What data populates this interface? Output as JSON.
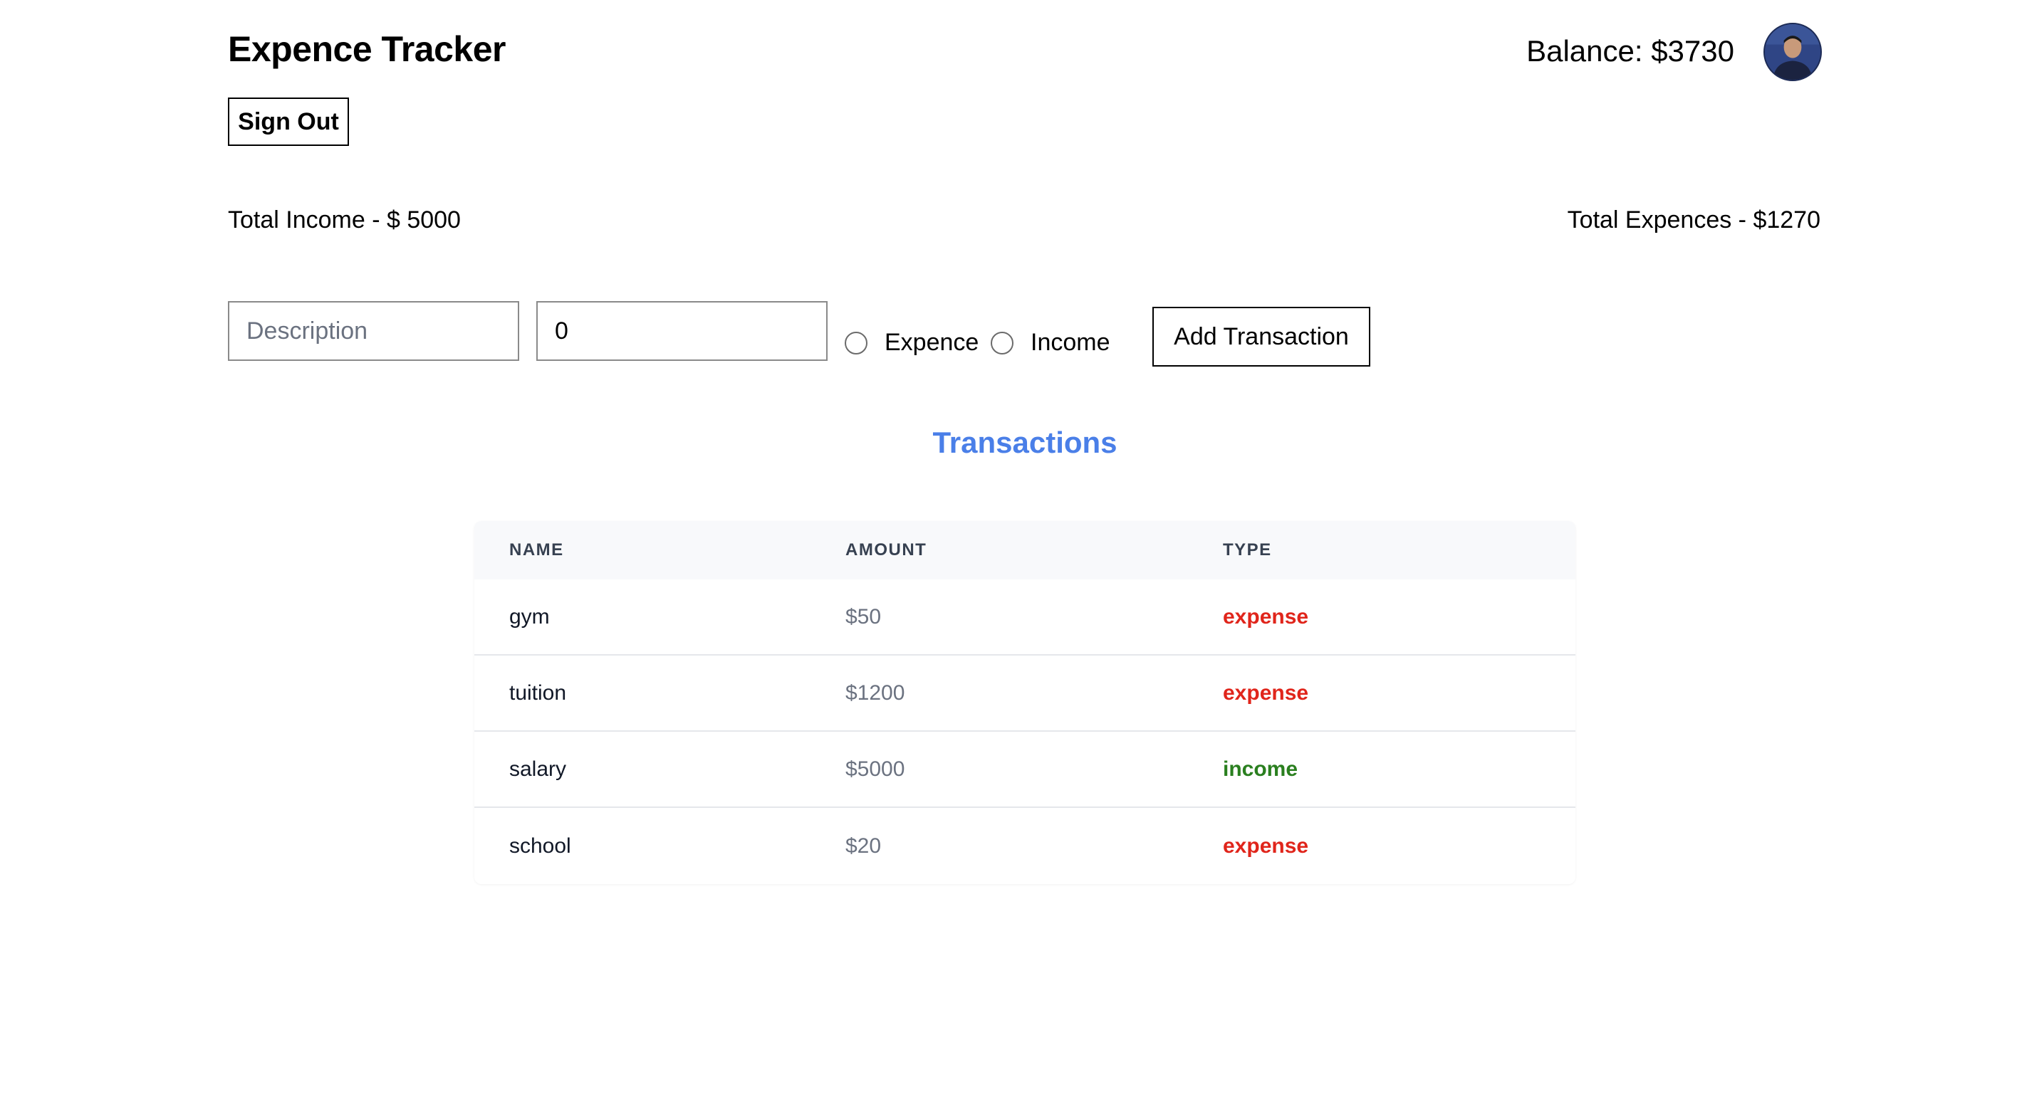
{
  "header": {
    "title": "Expence Tracker",
    "balance": "Balance: $3730",
    "sign_out_label": "Sign Out"
  },
  "totals": {
    "income": "Total Income - $ 5000",
    "expences": "Total Expences - $1270"
  },
  "form": {
    "description_placeholder": "Description",
    "description_value": "",
    "amount_value": "0",
    "radio_expence_label": "Expence",
    "radio_income_label": "Income",
    "add_button_label": "Add Transaction"
  },
  "transactions": {
    "title": "Transactions",
    "columns": [
      "NAME",
      "AMOUNT",
      "TYPE"
    ],
    "rows": [
      {
        "name": "gym",
        "amount": "$50",
        "type": "expense"
      },
      {
        "name": "tuition",
        "amount": "$1200",
        "type": "expense"
      },
      {
        "name": "salary",
        "amount": "$5000",
        "type": "income"
      },
      {
        "name": "school",
        "amount": "$20",
        "type": "expense"
      }
    ]
  },
  "colors": {
    "accent": "#4a7fe8",
    "expense": "#e0251b",
    "income": "#2a7f1f"
  },
  "icons": {
    "avatar": "user-avatar"
  }
}
